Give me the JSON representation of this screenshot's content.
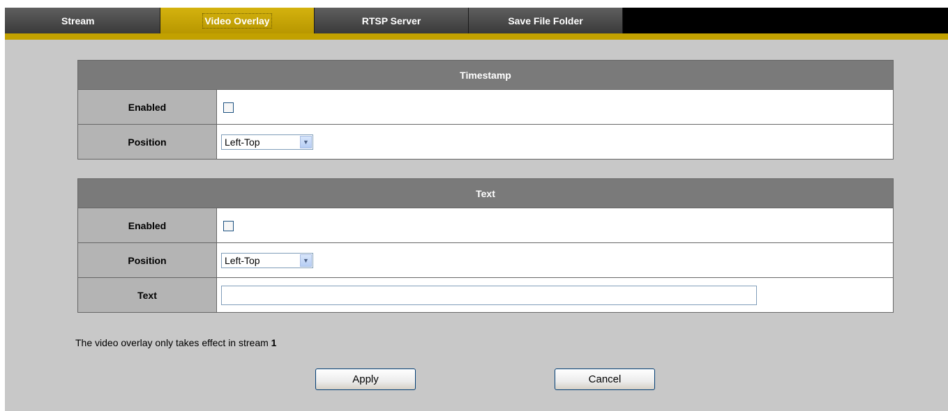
{
  "tabs": [
    {
      "label": "Stream",
      "active": false
    },
    {
      "label": "Video Overlay",
      "active": true
    },
    {
      "label": "RTSP Server",
      "active": false
    },
    {
      "label": "Save File Folder",
      "active": false
    }
  ],
  "timestamp": {
    "header": "Timestamp",
    "enabled_label": "Enabled",
    "enabled_checked": false,
    "position_label": "Position",
    "position_value": "Left-Top"
  },
  "text_section": {
    "header": "Text",
    "enabled_label": "Enabled",
    "enabled_checked": false,
    "position_label": "Position",
    "position_value": "Left-Top",
    "text_label": "Text",
    "text_value": ""
  },
  "note": {
    "text": "The video overlay only takes effect in stream ",
    "stream_number": "1"
  },
  "buttons": {
    "apply": "Apply",
    "cancel": "Cancel"
  },
  "colors": {
    "active_tab": "#c2a100",
    "header_bg": "#7a7a7a",
    "content_bg": "#c8c8c8"
  }
}
